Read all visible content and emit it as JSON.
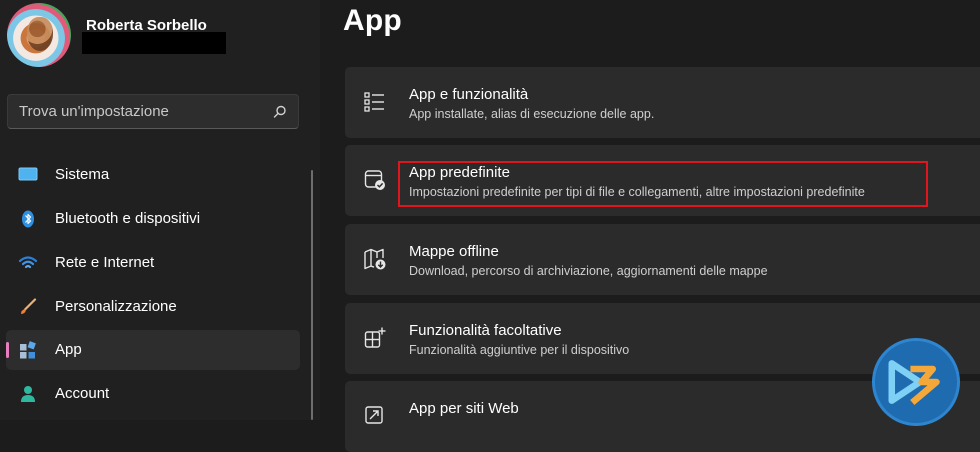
{
  "profile": {
    "name": "Roberta Sorbello"
  },
  "search": {
    "placeholder": "Trova un'impostazione"
  },
  "nav": [
    {
      "label": "Sistema",
      "icon": "monitor-icon"
    },
    {
      "label": "Bluetooth e dispositivi",
      "icon": "bluetooth-icon"
    },
    {
      "label": "Rete e Internet",
      "icon": "wifi-icon"
    },
    {
      "label": "Personalizzazione",
      "icon": "brush-icon"
    },
    {
      "label": "App",
      "icon": "apps-icon",
      "active": true
    },
    {
      "label": "Account",
      "icon": "user-icon"
    }
  ],
  "page": {
    "title": "App"
  },
  "cards": [
    {
      "title": "App e funzionalità",
      "subtitle": "App installate, alias di esecuzione delle app.",
      "icon": "list-icon"
    },
    {
      "title": "App predefinite",
      "subtitle": "Impostazioni predefinite per tipi di file e collegamenti, altre impostazioni predefinite",
      "icon": "default-apps-icon",
      "highlighted": true
    },
    {
      "title": "Mappe offline",
      "subtitle": "Download, percorso di archiviazione, aggiornamenti delle mappe",
      "icon": "map-icon"
    },
    {
      "title": "Funzionalità facoltative",
      "subtitle": "Funzionalità aggiuntive per il dispositivo",
      "icon": "add-feature-icon"
    },
    {
      "title": "App per siti Web",
      "subtitle": "",
      "icon": "web-apps-icon"
    }
  ],
  "colors": {
    "accent": "#e87ec0",
    "highlight": "#e0161e",
    "card": "#2b2b2b",
    "sidebar": "#202020"
  }
}
